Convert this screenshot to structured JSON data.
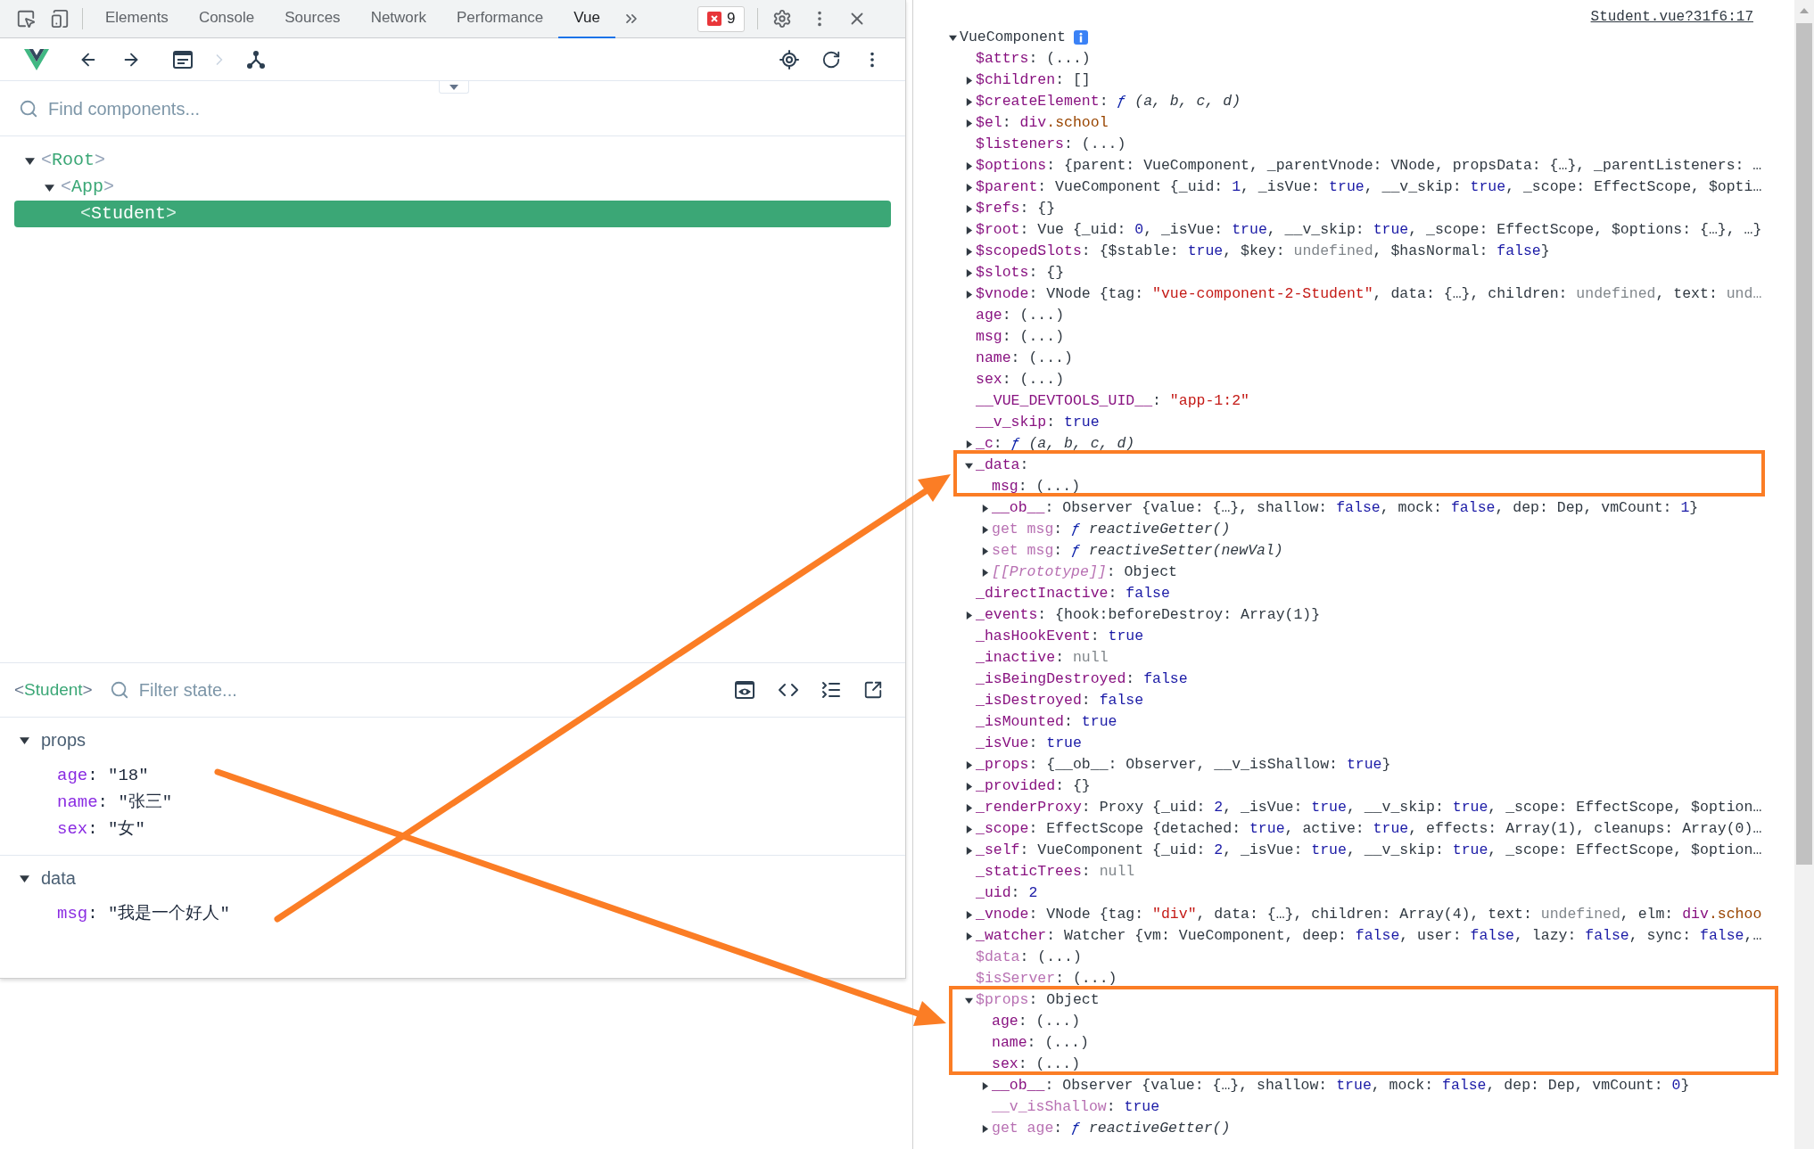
{
  "devtools_tabs": [
    {
      "label": "Elements",
      "selected": false
    },
    {
      "label": "Console",
      "selected": false
    },
    {
      "label": "Sources",
      "selected": false
    },
    {
      "label": "Network",
      "selected": false
    },
    {
      "label": "Performance",
      "selected": false
    },
    {
      "label": "Vue",
      "selected": true
    }
  ],
  "error_count": "9",
  "component_search": {
    "placeholder": "Find components..."
  },
  "component_tree": [
    {
      "open": "<",
      "name": "Root",
      "close": ">",
      "expanded": true,
      "selected": false,
      "children": [
        {
          "open": "<",
          "name": "App",
          "close": ">",
          "expanded": true,
          "selected": false,
          "children": [
            {
              "open": "<",
              "name": "Student",
              "close": ">",
              "selected": true
            }
          ]
        }
      ]
    }
  ],
  "state_header": {
    "component": {
      "open": "<",
      "name": "Student",
      "close": ">"
    },
    "filter": {
      "placeholder": "Filter state..."
    }
  },
  "state_sections": [
    {
      "title": "props",
      "expanded": true,
      "fields": [
        {
          "key": "age",
          "value": ": \"18\""
        },
        {
          "key": "name",
          "value": ": \"张三\""
        },
        {
          "key": "sex",
          "value": ": \"女\""
        }
      ]
    },
    {
      "title": "data",
      "expanded": true,
      "fields": [
        {
          "key": "msg",
          "value": ": \"我是一个好人\""
        }
      ]
    }
  ],
  "source_link": "Student.vue?31f6:17",
  "object_tree": {
    "key": "VueComponent",
    "kind": "plain",
    "expanded": true,
    "children": [
      {
        "key": "$attrs",
        "kind": "own",
        "value": [
          {
            "text": ": (...)",
            "kind": "plain"
          }
        ]
      },
      {
        "key": "$children",
        "kind": "own",
        "expanded": false,
        "value": [
          {
            "text": ": []",
            "kind": "plain"
          }
        ]
      },
      {
        "key": "$createElement",
        "kind": "own",
        "expanded": false,
        "value": [
          {
            "text": ": ",
            "kind": "plain"
          },
          {
            "text": "ƒ",
            "kind": "fn"
          },
          {
            "text": " (a, b, c, d)",
            "kind": "italic"
          }
        ]
      },
      {
        "key": "$el",
        "kind": "own",
        "expanded": false,
        "value": [
          {
            "text": ": ",
            "kind": "plain"
          },
          {
            "text": "div",
            "kind": "tag"
          },
          {
            "text": ".school",
            "kind": "class"
          }
        ]
      },
      {
        "key": "$listeners",
        "kind": "own",
        "value": [
          {
            "text": ": (...)",
            "kind": "plain"
          }
        ]
      },
      {
        "key": "$options",
        "kind": "own",
        "expanded": false,
        "value": [
          {
            "text": ": {parent: VueComponent, _parentVnode: VNode, propsData: {…}, _parentListeners: …",
            "kind": "plain"
          }
        ]
      },
      {
        "key": "$parent",
        "kind": "own",
        "expanded": false,
        "value": [
          {
            "text": ": VueComponent {_uid: ",
            "kind": "plain"
          },
          {
            "text": "1",
            "kind": "keyword"
          },
          {
            "text": ", _isVue: ",
            "kind": "plain"
          },
          {
            "text": "true",
            "kind": "keyword"
          },
          {
            "text": ", __v_skip: ",
            "kind": "plain"
          },
          {
            "text": "true",
            "kind": "keyword"
          },
          {
            "text": ", _scope: EffectScope, $opti…",
            "kind": "plain"
          }
        ]
      },
      {
        "key": "$refs",
        "kind": "own",
        "expanded": false,
        "value": [
          {
            "text": ": {}",
            "kind": "plain"
          }
        ]
      },
      {
        "key": "$root",
        "kind": "own",
        "expanded": false,
        "value": [
          {
            "text": ": Vue {_uid: ",
            "kind": "plain"
          },
          {
            "text": "0",
            "kind": "keyword"
          },
          {
            "text": ", _isVue: ",
            "kind": "plain"
          },
          {
            "text": "true",
            "kind": "keyword"
          },
          {
            "text": ", __v_skip: ",
            "kind": "plain"
          },
          {
            "text": "true",
            "kind": "keyword"
          },
          {
            "text": ", _scope: EffectScope, $options: {…}, …}",
            "kind": "plain"
          }
        ]
      },
      {
        "key": "$scopedSlots",
        "kind": "own",
        "expanded": false,
        "value": [
          {
            "text": ": {$stable: ",
            "kind": "plain"
          },
          {
            "text": "true",
            "kind": "keyword"
          },
          {
            "text": ", $key: ",
            "kind": "plain"
          },
          {
            "text": "undefined",
            "kind": "nil"
          },
          {
            "text": ", $hasNormal: ",
            "kind": "plain"
          },
          {
            "text": "false",
            "kind": "keyword"
          },
          {
            "text": "}",
            "kind": "plain"
          }
        ]
      },
      {
        "key": "$slots",
        "kind": "own",
        "expanded": false,
        "value": [
          {
            "text": ": {}",
            "kind": "plain"
          }
        ]
      },
      {
        "key": "$vnode",
        "kind": "own",
        "expanded": false,
        "value": [
          {
            "text": ": VNode {tag: ",
            "kind": "plain"
          },
          {
            "text": "\"vue-component-2-Student\"",
            "kind": "string"
          },
          {
            "text": ", data: {…}, children: ",
            "kind": "plain"
          },
          {
            "text": "undefined",
            "kind": "nil"
          },
          {
            "text": ", text: ",
            "kind": "plain"
          },
          {
            "text": "und…",
            "kind": "nil"
          }
        ]
      },
      {
        "key": "age",
        "kind": "own",
        "value": [
          {
            "text": ": (...)",
            "kind": "plain"
          }
        ]
      },
      {
        "key": "msg",
        "kind": "own",
        "value": [
          {
            "text": ": (...)",
            "kind": "plain"
          }
        ]
      },
      {
        "key": "name",
        "kind": "own",
        "value": [
          {
            "text": ": (...)",
            "kind": "plain"
          }
        ]
      },
      {
        "key": "sex",
        "kind": "own",
        "value": [
          {
            "text": ": (...)",
            "kind": "plain"
          }
        ]
      },
      {
        "key": "__VUE_DEVTOOLS_UID__",
        "kind": "own",
        "value": [
          {
            "text": ": ",
            "kind": "plain"
          },
          {
            "text": "\"app-1:2\"",
            "kind": "string"
          }
        ]
      },
      {
        "key": "__v_skip",
        "kind": "own",
        "value": [
          {
            "text": ": ",
            "kind": "plain"
          },
          {
            "text": "true",
            "kind": "keyword"
          }
        ]
      },
      {
        "key": "_c",
        "kind": "own",
        "expanded": false,
        "value": [
          {
            "text": ": ",
            "kind": "plain"
          },
          {
            "text": "ƒ",
            "kind": "fn"
          },
          {
            "text": " (a, b, c, d)",
            "kind": "italic"
          }
        ]
      },
      {
        "key": "_data",
        "kind": "own",
        "expanded": true,
        "value": [
          {
            "text": ":",
            "kind": "plain"
          }
        ],
        "children": [
          {
            "key": "msg",
            "kind": "own",
            "value": [
              {
                "text": ": (...)",
                "kind": "plain"
              }
            ]
          },
          {
            "key": "__ob__",
            "kind": "own",
            "expanded": false,
            "value": [
              {
                "text": ": Observer {value: {…}, shallow: ",
                "kind": "plain"
              },
              {
                "text": "false",
                "kind": "keyword"
              },
              {
                "text": ", mock: ",
                "kind": "plain"
              },
              {
                "text": "false",
                "kind": "keyword"
              },
              {
                "text": ", dep: Dep, vmCount: ",
                "kind": "plain"
              },
              {
                "text": "1",
                "kind": "keyword"
              },
              {
                "text": "}",
                "kind": "plain"
              }
            ]
          },
          {
            "key": "get msg",
            "kind": "faded",
            "expanded": false,
            "value": [
              {
                "text": ": ",
                "kind": "plain"
              },
              {
                "text": "ƒ",
                "kind": "fn"
              },
              {
                "text": " reactiveGetter()",
                "kind": "italic"
              }
            ]
          },
          {
            "key": "set msg",
            "kind": "faded",
            "expanded": false,
            "value": [
              {
                "text": ": ",
                "kind": "plain"
              },
              {
                "text": "ƒ",
                "kind": "fn"
              },
              {
                "text": " reactiveSetter(newVal)",
                "kind": "italic"
              }
            ]
          },
          {
            "key": "[[Prototype]]",
            "kind": "slot",
            "expanded": false,
            "value": [
              {
                "text": ": Object",
                "kind": "plain"
              }
            ]
          }
        ]
      },
      {
        "key": "_directInactive",
        "kind": "own",
        "value": [
          {
            "text": ": ",
            "kind": "plain"
          },
          {
            "text": "false",
            "kind": "keyword"
          }
        ]
      },
      {
        "key": "_events",
        "kind": "own",
        "expanded": false,
        "value": [
          {
            "text": ": {hook:beforeDestroy: Array(1)}",
            "kind": "plain"
          }
        ]
      },
      {
        "key": "_hasHookEvent",
        "kind": "own",
        "value": [
          {
            "text": ": ",
            "kind": "plain"
          },
          {
            "text": "true",
            "kind": "keyword"
          }
        ]
      },
      {
        "key": "_inactive",
        "kind": "own",
        "value": [
          {
            "text": ": ",
            "kind": "plain"
          },
          {
            "text": "null",
            "kind": "nil"
          }
        ]
      },
      {
        "key": "_isBeingDestroyed",
        "kind": "own",
        "value": [
          {
            "text": ": ",
            "kind": "plain"
          },
          {
            "text": "false",
            "kind": "keyword"
          }
        ]
      },
      {
        "key": "_isDestroyed",
        "kind": "own",
        "value": [
          {
            "text": ": ",
            "kind": "plain"
          },
          {
            "text": "false",
            "kind": "keyword"
          }
        ]
      },
      {
        "key": "_isMounted",
        "kind": "own",
        "value": [
          {
            "text": ": ",
            "kind": "plain"
          },
          {
            "text": "true",
            "kind": "keyword"
          }
        ]
      },
      {
        "key": "_isVue",
        "kind": "own",
        "value": [
          {
            "text": ": ",
            "kind": "plain"
          },
          {
            "text": "true",
            "kind": "keyword"
          }
        ]
      },
      {
        "key": "_props",
        "kind": "own",
        "expanded": false,
        "value": [
          {
            "text": ": {__ob__: Observer, __v_isShallow: ",
            "kind": "plain"
          },
          {
            "text": "true",
            "kind": "keyword"
          },
          {
            "text": "}",
            "kind": "plain"
          }
        ]
      },
      {
        "key": "_provided",
        "kind": "own",
        "expanded": false,
        "value": [
          {
            "text": ": {}",
            "kind": "plain"
          }
        ]
      },
      {
        "key": "_renderProxy",
        "kind": "own",
        "expanded": false,
        "value": [
          {
            "text": ": Proxy {_uid: ",
            "kind": "plain"
          },
          {
            "text": "2",
            "kind": "keyword"
          },
          {
            "text": ", _isVue: ",
            "kind": "plain"
          },
          {
            "text": "true",
            "kind": "keyword"
          },
          {
            "text": ", __v_skip: ",
            "kind": "plain"
          },
          {
            "text": "true",
            "kind": "keyword"
          },
          {
            "text": ", _scope: EffectScope, $option…",
            "kind": "plain"
          }
        ]
      },
      {
        "key": "_scope",
        "kind": "own",
        "expanded": false,
        "value": [
          {
            "text": ": EffectScope {detached: ",
            "kind": "plain"
          },
          {
            "text": "true",
            "kind": "keyword"
          },
          {
            "text": ", active: ",
            "kind": "plain"
          },
          {
            "text": "true",
            "kind": "keyword"
          },
          {
            "text": ", effects: Array(1), cleanups: Array(0)…",
            "kind": "plain"
          }
        ]
      },
      {
        "key": "_self",
        "kind": "own",
        "expanded": false,
        "value": [
          {
            "text": ": VueComponent {_uid: ",
            "kind": "plain"
          },
          {
            "text": "2",
            "kind": "keyword"
          },
          {
            "text": ", _isVue: ",
            "kind": "plain"
          },
          {
            "text": "true",
            "kind": "keyword"
          },
          {
            "text": ", __v_skip: ",
            "kind": "plain"
          },
          {
            "text": "true",
            "kind": "keyword"
          },
          {
            "text": ", _scope: EffectScope, $option…",
            "kind": "plain"
          }
        ]
      },
      {
        "key": "_staticTrees",
        "kind": "own",
        "value": [
          {
            "text": ": ",
            "kind": "plain"
          },
          {
            "text": "null",
            "kind": "nil"
          }
        ]
      },
      {
        "key": "_uid",
        "kind": "own",
        "value": [
          {
            "text": ": ",
            "kind": "plain"
          },
          {
            "text": "2",
            "kind": "keyword"
          }
        ]
      },
      {
        "key": "_vnode",
        "kind": "own",
        "expanded": false,
        "value": [
          {
            "text": ": VNode {tag: ",
            "kind": "plain"
          },
          {
            "text": "\"div\"",
            "kind": "string"
          },
          {
            "text": ", data: {…}, children: Array(4), text: ",
            "kind": "plain"
          },
          {
            "text": "undefined",
            "kind": "nil"
          },
          {
            "text": ", elm: ",
            "kind": "plain"
          },
          {
            "text": "div",
            "kind": "tag"
          },
          {
            "text": ".schoo",
            "kind": "class"
          }
        ]
      },
      {
        "key": "_watcher",
        "kind": "own",
        "expanded": false,
        "value": [
          {
            "text": ": Watcher {vm: VueComponent, deep: ",
            "kind": "plain"
          },
          {
            "text": "false",
            "kind": "keyword"
          },
          {
            "text": ", user: ",
            "kind": "plain"
          },
          {
            "text": "false",
            "kind": "keyword"
          },
          {
            "text": ", lazy: ",
            "kind": "plain"
          },
          {
            "text": "false",
            "kind": "keyword"
          },
          {
            "text": ", sync: ",
            "kind": "plain"
          },
          {
            "text": "false",
            "kind": "keyword"
          },
          {
            "text": ",…",
            "kind": "plain"
          }
        ]
      },
      {
        "key": "$data",
        "kind": "faded",
        "value": [
          {
            "text": ": (...)",
            "kind": "plain"
          }
        ]
      },
      {
        "key": "$isServer",
        "kind": "faded",
        "value": [
          {
            "text": ": (...)",
            "kind": "plain"
          }
        ]
      },
      {
        "key": "$props",
        "kind": "faded",
        "expanded": true,
        "value": [
          {
            "text": ": Object",
            "kind": "plain"
          }
        ],
        "children": [
          {
            "key": "age",
            "kind": "own",
            "value": [
              {
                "text": ": (...)",
                "kind": "plain"
              }
            ]
          },
          {
            "key": "name",
            "kind": "own",
            "value": [
              {
                "text": ": (...)",
                "kind": "plain"
              }
            ]
          },
          {
            "key": "sex",
            "kind": "own",
            "value": [
              {
                "text": ": (...)",
                "kind": "plain"
              }
            ]
          },
          {
            "key": "__ob__",
            "kind": "own",
            "expanded": false,
            "value": [
              {
                "text": ": Observer {value: {…}, shallow: ",
                "kind": "plain"
              },
              {
                "text": "true",
                "kind": "keyword"
              },
              {
                "text": ", mock: ",
                "kind": "plain"
              },
              {
                "text": "false",
                "kind": "keyword"
              },
              {
                "text": ", dep: Dep, vmCount: ",
                "kind": "plain"
              },
              {
                "text": "0",
                "kind": "keyword"
              },
              {
                "text": "}",
                "kind": "plain"
              }
            ]
          },
          {
            "key": "__v_isShallow",
            "kind": "faded",
            "value": [
              {
                "text": ": ",
                "kind": "plain"
              },
              {
                "text": "true",
                "kind": "keyword"
              }
            ]
          },
          {
            "key": "get age",
            "kind": "faded",
            "expanded": false,
            "value": [
              {
                "text": ": ",
                "kind": "plain"
              },
              {
                "text": "ƒ",
                "kind": "fn"
              },
              {
                "text": " reactiveGetter()",
                "kind": "italic"
              }
            ]
          }
        ]
      }
    ]
  }
}
